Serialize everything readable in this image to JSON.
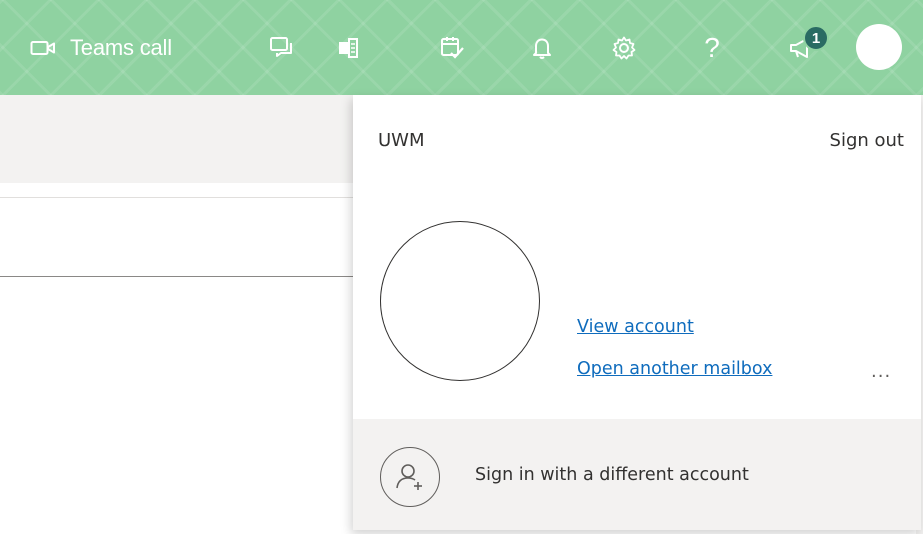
{
  "header": {
    "teams_call_label": "Teams call",
    "help_glyph": "?",
    "notification_count": "1",
    "icons": [
      "video-icon",
      "chat-icon",
      "office-icon",
      "todo-icon",
      "bell-icon",
      "gear-icon",
      "help-icon",
      "feedback-icon"
    ],
    "background_color": "#8fd2a1"
  },
  "account_flyout": {
    "org_name": "UWM",
    "sign_out_label": "Sign out",
    "view_account_label": "View account",
    "open_mailbox_label": "Open another mailbox",
    "more_label": "...",
    "different_account_label": "Sign in with a different account",
    "link_color": "#0f6cbd"
  }
}
